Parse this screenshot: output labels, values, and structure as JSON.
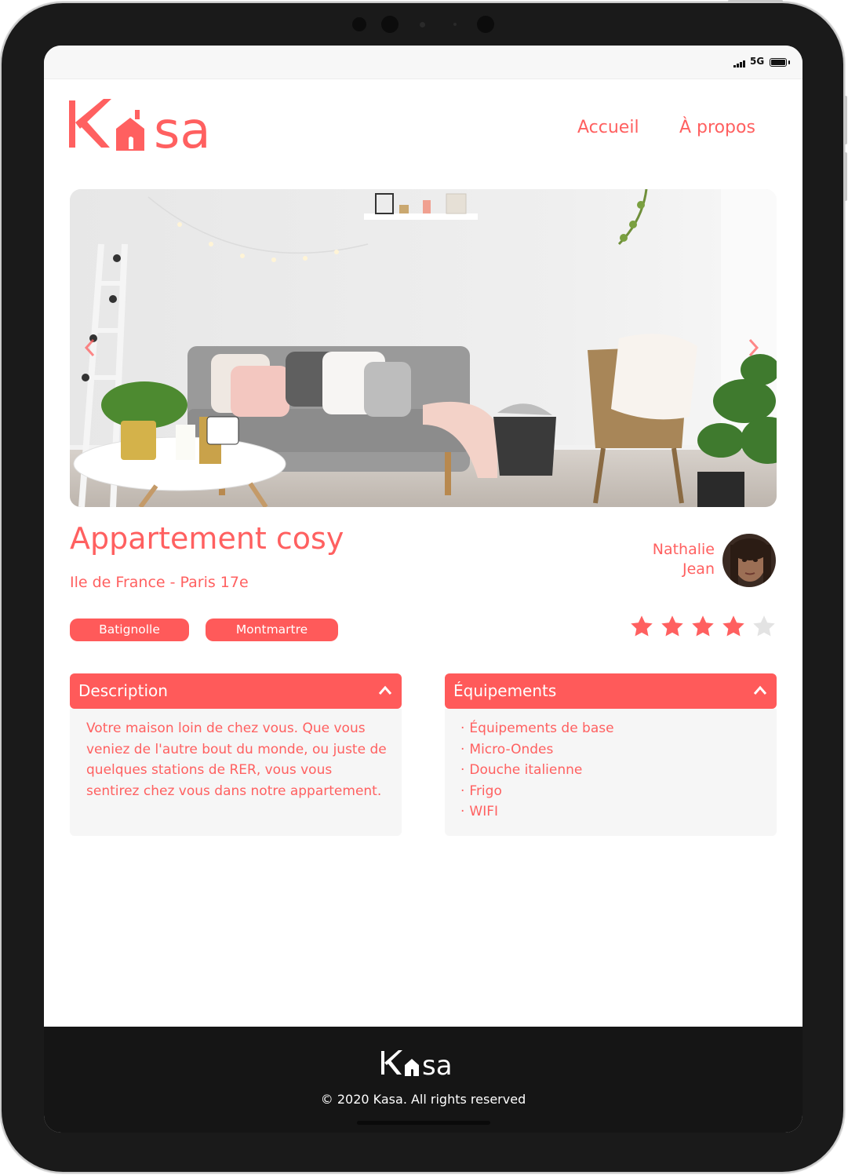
{
  "status_bar": {
    "network": "5G"
  },
  "header": {
    "brand": "Kasa",
    "nav": [
      {
        "label": "Accueil"
      },
      {
        "label": "À propos"
      }
    ]
  },
  "gallery": {
    "prev_icon": "chevron-left-icon",
    "next_icon": "chevron-right-icon"
  },
  "listing": {
    "title": "Appartement cosy",
    "location": "Ile de France - Paris 17e",
    "host": {
      "first_name": "Nathalie",
      "last_name": "Jean"
    },
    "tags": [
      "Batignolle",
      "Montmartre"
    ],
    "rating": 4,
    "rating_max": 5
  },
  "description": {
    "heading": "Description",
    "text": "Votre maison loin de chez vous. Que vous veniez de l'autre bout du monde, ou juste de quelques stations de RER, vous vous sentirez chez vous dans notre appartement."
  },
  "equipment": {
    "heading": "Équipements",
    "items": [
      "Équipements de base",
      "Micro-Ondes",
      "Douche italienne",
      "Frigo",
      "WIFI"
    ]
  },
  "footer": {
    "brand": "Kasa",
    "copyright": "© 2020 Kasa. All rights reserved"
  },
  "colors": {
    "accent": "#FF6060",
    "tag_bg": "#FF5A5A",
    "panel_bg": "#F6F6F6",
    "star_empty": "#E3E3E3",
    "footer_bg": "#151515"
  }
}
